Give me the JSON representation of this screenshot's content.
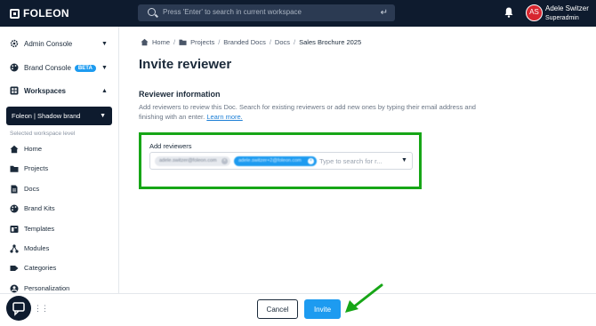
{
  "colors": {
    "topbar": "#0e1b2e",
    "accent": "#1d9bf0",
    "highlight": "#17a617",
    "avatar": "#d7262f"
  },
  "topbar": {
    "logo_text": "FOLEON",
    "search_placeholder": "Press 'Enter' to search in current workspace",
    "user_initials": "AS",
    "user_name": "Adele Switzer",
    "user_role": "Superadmin"
  },
  "sidebar": {
    "admin_console": "Admin Console",
    "brand_console": "Brand Console",
    "beta_badge": "BETA",
    "workspaces": "Workspaces",
    "selected_brand": "Foleon | Shadow brand",
    "level_label": "Selected workspace level",
    "nav": [
      {
        "label": "Home",
        "icon": "home-icon"
      },
      {
        "label": "Projects",
        "icon": "folder-icon"
      },
      {
        "label": "Docs",
        "icon": "doc-icon"
      },
      {
        "label": "Brand Kits",
        "icon": "palette-icon"
      },
      {
        "label": "Templates",
        "icon": "template-icon"
      },
      {
        "label": "Modules",
        "icon": "modules-icon"
      },
      {
        "label": "Categories",
        "icon": "tag-icon"
      },
      {
        "label": "Personalization",
        "icon": "person-icon"
      }
    ]
  },
  "breadcrumb": {
    "home": "Home",
    "projects": "Projects",
    "branded_docs": "Branded Docs",
    "docs": "Docs",
    "current": "Sales Brochure 2025"
  },
  "main": {
    "title": "Invite reviewer",
    "section_title": "Reviewer information",
    "description": "Add reviewers to review this Doc. Search for existing reviewers or add new ones by typing their email address and finishing with an enter.",
    "learn_more": "Learn more.",
    "add_label": "Add reviewers",
    "chips": [
      "adele.switzer@foleon.com",
      "adele.switzer+2@foleon.com"
    ],
    "field_placeholder": "Type to search for r..."
  },
  "footer": {
    "cancel_label": "Cancel",
    "invite_label": "Invite"
  }
}
